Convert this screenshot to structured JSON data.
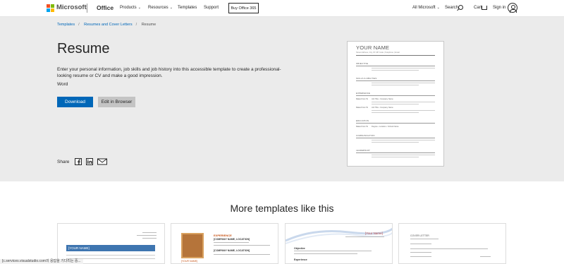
{
  "header": {
    "brand": "Microsoft",
    "product": "Office",
    "nav": [
      {
        "label": "Products",
        "dropdown": true
      },
      {
        "label": "Resources",
        "dropdown": true
      },
      {
        "label": "Templates",
        "dropdown": false
      },
      {
        "label": "Support",
        "dropdown": false
      }
    ],
    "buy_label": "Buy Office 365",
    "all_microsoft": "All Microsoft",
    "search_label": "Search",
    "cart_label": "Cart",
    "signin_label": "Sign in",
    "logo_colors": [
      "#f25022",
      "#7fba00",
      "#00a4ef",
      "#ffb900"
    ]
  },
  "breadcrumb": [
    "Templates",
    "Resumes and Cover Letters",
    "Resume"
  ],
  "hero": {
    "title": "Resume",
    "description": "Enter your personal information, job skills and job history into this accessible template to create a professional-looking resume or CV and make a good impression.",
    "app": "Word",
    "download_label": "Download",
    "edit_label": "Edit in Browser",
    "share_label": "Share"
  },
  "preview": {
    "name": "YOUR NAME",
    "contact": "Street Address, City, ST ZIP Code | Telephone | Email",
    "sections": [
      "OBJECTIVE",
      "SKILLS & ABILITIES",
      "EXPERIENCE",
      "EDUCATION",
      "COMMUNICATION",
      "LEADERSHIP"
    ],
    "dates_label": "Dates From To",
    "job_label": "Job Title • Company Name",
    "school_label": "Degree • Location • School Name"
  },
  "more_title": "More templates like this",
  "cards": [
    {
      "name_label": "[YOUR NAME]"
    },
    {
      "heading": "EXPERIENCE",
      "company": "[COMPANY NAME, LOCATION]",
      "name": "[YOUR NAME]"
    },
    {
      "name": "[Your Name]",
      "objective": "Objective",
      "experience": "Experience"
    },
    {
      "heading": "COVER LETTER"
    }
  ],
  "status_text": "[c.services.visualstudio.com의 응답을 기다리는 중..."
}
